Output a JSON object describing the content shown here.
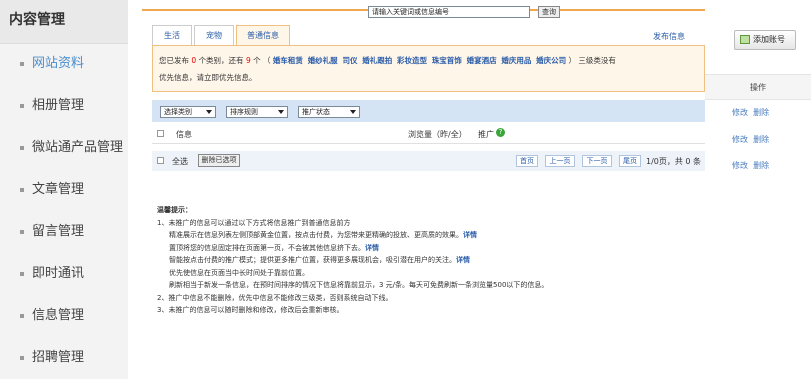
{
  "sidebar": {
    "title": "内容管理",
    "items": [
      {
        "label": "网站资料"
      },
      {
        "label": "相册管理"
      },
      {
        "label": "微站通产品管理"
      },
      {
        "label": "文章管理"
      },
      {
        "label": "留言管理"
      },
      {
        "label": "即时通讯"
      },
      {
        "label": "信息管理"
      },
      {
        "label": "招聘管理"
      }
    ]
  },
  "tabs": [
    {
      "label": "生活"
    },
    {
      "label": "宠物"
    },
    {
      "label": "普通信息"
    }
  ],
  "publish_link": "发布信息",
  "notice": {
    "p1": "您已发布",
    "count_published": "0",
    "p2": "个类别，还有",
    "count_remaining": "9",
    "p3": "个 （",
    "categories": [
      "婚车租赁",
      "婚纱礼服",
      "司仪",
      "婚礼跟拍",
      "彩妆造型",
      "珠宝首饰",
      "婚宴酒店",
      "婚庆用品",
      "婚庆公司"
    ],
    "p4": "） 三级类没有",
    "line2": "优先信息，请立即优先信息。"
  },
  "filter": {
    "category": "选择类别",
    "sort": "排序规则",
    "promo_status": "推广状态",
    "keyword_value": "请输入关键词或信息编号",
    "query_button": "查询"
  },
  "table": {
    "col_info": "信息",
    "col_views": "浏览量（昨/全）",
    "col_promo": "推广"
  },
  "footer": {
    "select_all": "全选",
    "delete_selected": "删除已选项",
    "first": "首页",
    "prev": "上一页",
    "next": "下一页",
    "last": "尾页",
    "page_info": "1/0页，共 0 条"
  },
  "right": {
    "add_account": "添加账号",
    "ops_header": "操作",
    "rows": [
      {
        "edit": "修改",
        "del": "删除"
      },
      {
        "edit": "修改",
        "del": "删除"
      },
      {
        "edit": "修改",
        "del": "删除"
      }
    ]
  },
  "tips": {
    "title": "温馨提示：",
    "l1": "1、未推广的信息可以通过以下方式将信息推广到普通信息前方",
    "l2": "精准展示在信息列表左侧顶部黄金位置，按点击付费，为您带来更精确的投放、更高质的效果。",
    "l3": "置顶将您的信息固定排在页面第一页，不会被其他信息挤下去。",
    "l4": "智能按点击付费的推广模式；提供更多推广位置，获得更多展现机会，吸引潜在用户的关注。",
    "l5": "优先使信息在页面当中长时间处于靠前位置。",
    "l6": "刷新相当于新发一条信息，在预时间排序的情况下信息将靠前显示，3 元/条。每天可免费刷新一条浏览量500以下的信息。",
    "l7": "2、推广中信息不能删除，优先中信息不能修改三级类，否则系统自动下线。",
    "l8": "3、未推广的信息可以随时删除和修改，修改后会重新审核。",
    "detail": "详情"
  }
}
